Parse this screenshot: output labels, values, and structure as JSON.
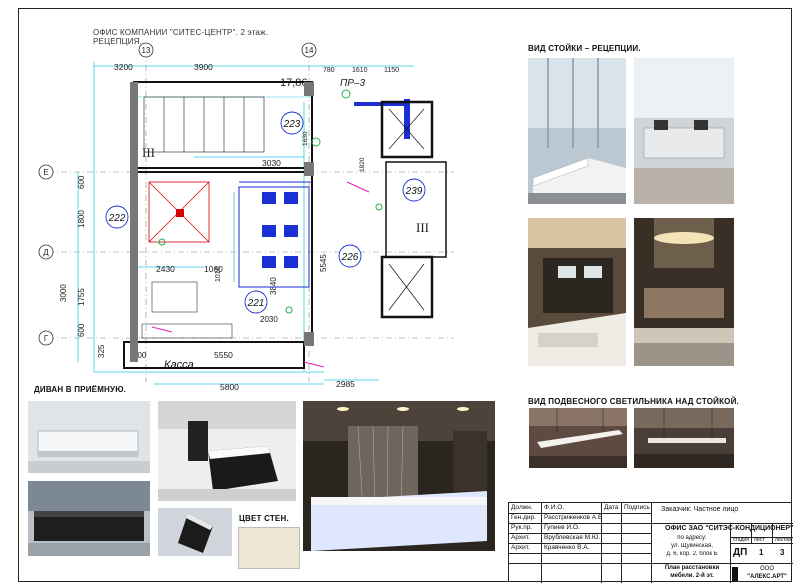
{
  "plan": {
    "title_line1": "ОФИС КОМПАНИИ \"СИТЕС-ЦЕНТР\". 2 этаж.",
    "title_line2": "РЕЦЕПЦИЯ.",
    "axes": {
      "a13": "13",
      "a14": "14",
      "aE": "Е",
      "aD": "Д",
      "aG": "Г"
    },
    "dims": {
      "d3900": "3900",
      "d3200": "3200",
      "d780": "780",
      "d1610": "1610",
      "d1150": "1150",
      "d1786": "17,86",
      "dPR3": "ПР–3",
      "d3030": "3030",
      "d600a": "600",
      "d1800": "1800",
      "d3000": "3000",
      "d1755": "1755",
      "d600b": "600",
      "d325": "325",
      "d2430": "2430",
      "d1060": "1060",
      "d3840": "3840",
      "d1010": "1010",
      "d5545": "5545",
      "d2030": "2030",
      "d600c": "600",
      "d5550": "5550",
      "d5800": "5800",
      "d2985": "2985",
      "d1630": "1630",
      "d1820": "1820"
    },
    "rooms": {
      "r223": "223",
      "r222": "222",
      "r221": "221",
      "r226": "226",
      "r239": "239"
    },
    "roman": {
      "left": "III",
      "right": "III"
    },
    "kassa": "Касса"
  },
  "sections": {
    "reception": "ВИД СТОЙКИ – РЕЦЕПЦИИ.",
    "sofa": "ДИВАН В ПРИЁМНУЮ.",
    "lamp": "ВИД ПОДВЕСНОГО СВЕТИЛЬНИКА НАД СТОЙКОЙ.",
    "wall": "ЦВЕТ СТЕН."
  },
  "titleblock": {
    "h_role": "Должн.",
    "h_name": "Ф.И.О.",
    "h_date": "Дата",
    "h_sign": "Подпись",
    "rows": [
      {
        "role": "Ген.дир.",
        "name": "Расстриженков А.В."
      },
      {
        "role": "Рук.пр.",
        "name": "Гупиев И.О."
      },
      {
        "role": "Архит.",
        "name": "Врублевская М.Ю."
      },
      {
        "role": "Архит.",
        "name": "Кравченко В.А."
      }
    ],
    "customer": "Заказчик:   Частное лицо",
    "office": "ОФИС ЗАО \"СИТЭС-КОНДИЦИОНЕР\"",
    "address1": "по адресу:",
    "address2": "ул. Щукинская,",
    "address3": "д. 6, кор. 2, блок Б",
    "h_stage": "стадия",
    "h_sheet": "лист",
    "h_sheets": "листов",
    "stage": "ДП",
    "sheet": "1",
    "sheets": "3",
    "drawing1": "План расстановки",
    "drawing2": "мебели. 2-й эт.",
    "company1": "ООО",
    "company2": "\"АЛЕКС.АРТ\""
  },
  "colors": {
    "cyan": "#2ec9e6",
    "blue": "#1a2fd4",
    "green": "#21b14b",
    "magenta": "#e020b0",
    "wall": "#ece6d2"
  }
}
